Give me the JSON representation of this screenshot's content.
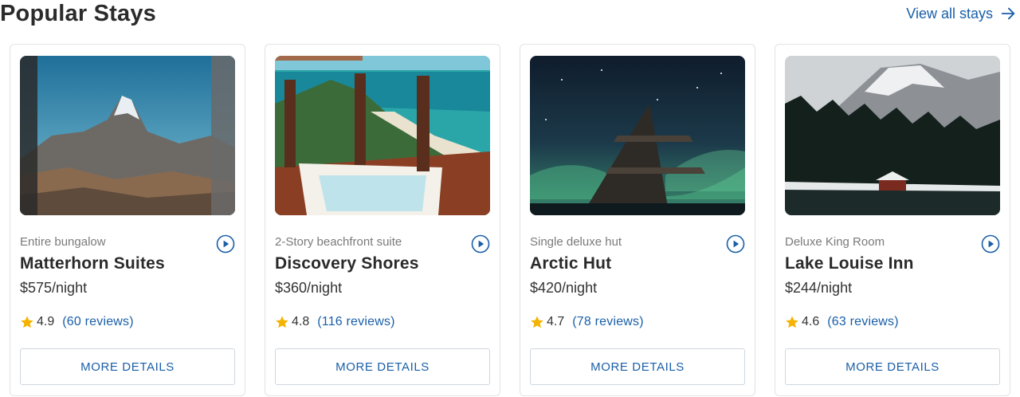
{
  "header": {
    "title": "Popular Stays",
    "view_all_label": "View all stays",
    "view_all_icon": "arrow-right-icon"
  },
  "colors": {
    "accent": "#1a5fa8",
    "star": "#f5b301",
    "border": "#e3e3e3"
  },
  "stays": [
    {
      "image": "matterhorn-mountain-photo",
      "subtitle": "Entire bungalow",
      "name": "Matterhorn Suites",
      "price": "$575/night",
      "rating": "4.9",
      "reviews": "(60 reviews)",
      "button": "MORE DETAILS"
    },
    {
      "image": "beachfront-deck-jacuzzi-photo",
      "subtitle": "2-Story beachfront suite",
      "name": "Discovery Shores",
      "price": "$360/night",
      "rating": "4.8",
      "reviews": "(116 reviews)",
      "button": "MORE DETAILS"
    },
    {
      "image": "aurora-hut-night-photo",
      "subtitle": "Single deluxe hut",
      "name": "Arctic Hut",
      "price": "$420/night",
      "rating": "4.7",
      "reviews": "(78 reviews)",
      "button": "MORE DETAILS"
    },
    {
      "image": "lake-louise-snowy-cabin-photo",
      "subtitle": "Deluxe King Room",
      "name": "Lake Louise Inn",
      "price": "$244/night",
      "rating": "4.6",
      "reviews": "(63 reviews)",
      "button": "MORE DETAILS"
    }
  ]
}
